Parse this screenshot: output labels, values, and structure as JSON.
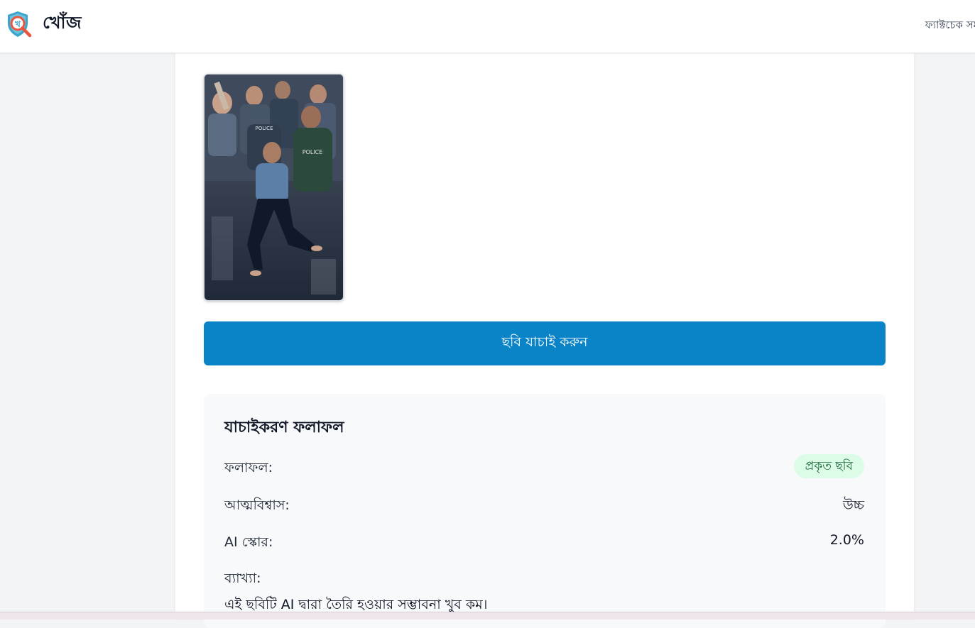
{
  "header": {
    "brand": "খোঁজ",
    "logo_letter": "খ",
    "nav_link": "ফ্যাক্টচেক সমূ"
  },
  "preview": {
    "police_text_1": "POLICE",
    "police_text_2": "POLICE"
  },
  "verify_button": {
    "label": "ছবি যাচাই করুন"
  },
  "result": {
    "title": "যাচাইকরণ ফলাফল",
    "verdict_label": "ফলাফল:",
    "verdict_value": "প্রকৃত ছবি",
    "confidence_label": "আত্মবিশ্বাস:",
    "confidence_value": "উচ্চ",
    "ai_score_label": "AI স্কোর:",
    "ai_score_value": "2.0%",
    "explanation_label": "ব্যাখ্যা:",
    "explanation_text": "এই ছবিটি AI দ্বারা তৈরি হওয়ার সম্ভাবনা খুব কম।"
  },
  "colors": {
    "primary_button": "#0a84c6",
    "badge_bg": "#dcfce7",
    "badge_text": "#166534",
    "logo_shield": "#3aa6c9",
    "logo_magnifier": "#e8563f"
  },
  "icons": {
    "logo": "shield-magnifier-icon"
  }
}
